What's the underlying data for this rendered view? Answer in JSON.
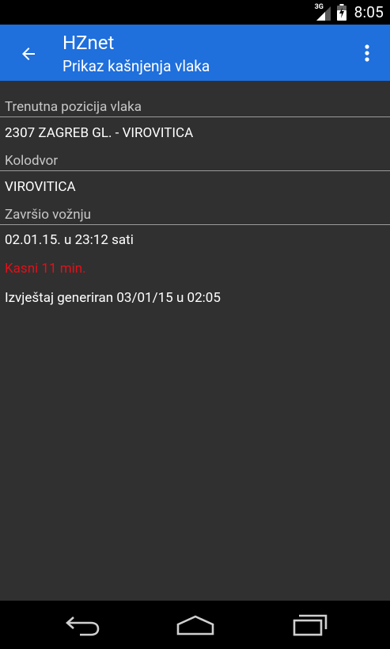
{
  "status_bar": {
    "network_type": "3G",
    "time": "8:05",
    "icons": [
      "signal-icon",
      "battery-charging-icon"
    ]
  },
  "app_bar": {
    "title": "HZnet",
    "subtitle": "Prikaz kašnjenja vlaka",
    "back_icon": "arrow-back-icon",
    "menu_icon": "overflow-menu-icon",
    "background_color": "#1f6fdc"
  },
  "content": {
    "position_label": "Trenutna pozicija vlaka",
    "train": "2307 ZAGREB GL. - VIROVITICA",
    "station_label": "Kolodvor",
    "station": "VIROVITICA",
    "status_label": "Završio vožnju",
    "datetime": "02.01.15. u 23:12 sati",
    "delay": "Kasni 11 min.",
    "delay_color": "#e0101a",
    "report": "Izvještaj generiran 03/01/15 u 02:05"
  },
  "nav_bar": {
    "icons": [
      "nav-back-icon",
      "nav-home-icon",
      "nav-recents-icon"
    ]
  }
}
